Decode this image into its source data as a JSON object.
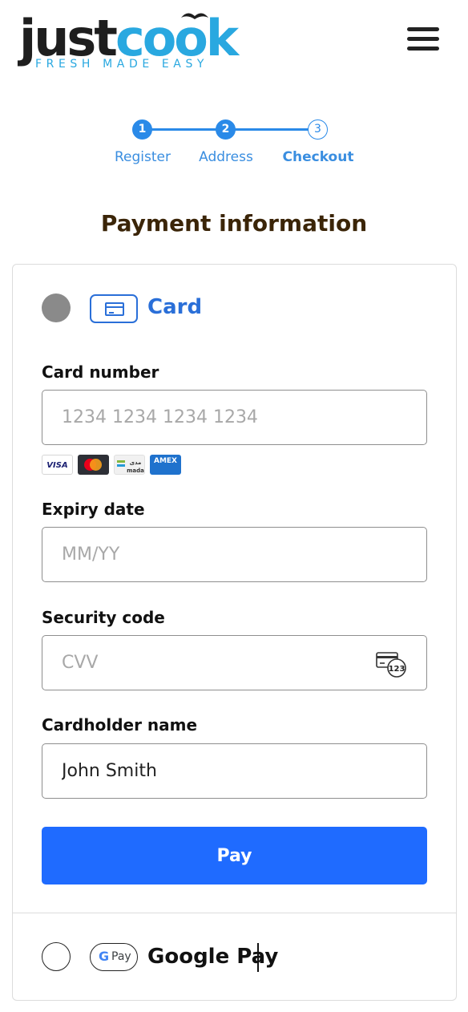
{
  "header": {
    "logo_just": "just",
    "logo_cook": "cook",
    "logo_tagline": "FRESH MADE EASY",
    "menu_icon": "hamburger-menu-icon"
  },
  "stepper": {
    "steps": [
      {
        "number": "1",
        "label": "Register",
        "state": "completed"
      },
      {
        "number": "2",
        "label": "Address",
        "state": "completed"
      },
      {
        "number": "3",
        "label": "Checkout",
        "state": "current"
      }
    ],
    "accent_color": "#2a8ae8"
  },
  "page_title": "Payment information",
  "payment": {
    "card": {
      "selected": true,
      "icon": "credit-card-icon",
      "label": "Card",
      "card_number": {
        "label": "Card number",
        "placeholder": "1234 1234 1234 1234",
        "value": ""
      },
      "brands": {
        "visa": "VISA",
        "mastercard": "mastercard",
        "mada": "مدى mada",
        "amex": "AMEX"
      },
      "expiry": {
        "label": "Expiry date",
        "placeholder": "MM/YY",
        "value": ""
      },
      "security_code": {
        "label": "Security code",
        "placeholder": "CVV",
        "value": "",
        "icon": "cvv-card-icon",
        "icon_text": "123"
      },
      "cardholder": {
        "label": "Cardholder name",
        "placeholder": "",
        "value": "John Smith"
      },
      "pay_button": "Pay",
      "pay_color": "#1f6bff"
    },
    "google_pay": {
      "selected": false,
      "icon": "google-pay-icon",
      "badge_g": "G",
      "badge_pay": "Pay",
      "label": "Google Pay"
    }
  }
}
